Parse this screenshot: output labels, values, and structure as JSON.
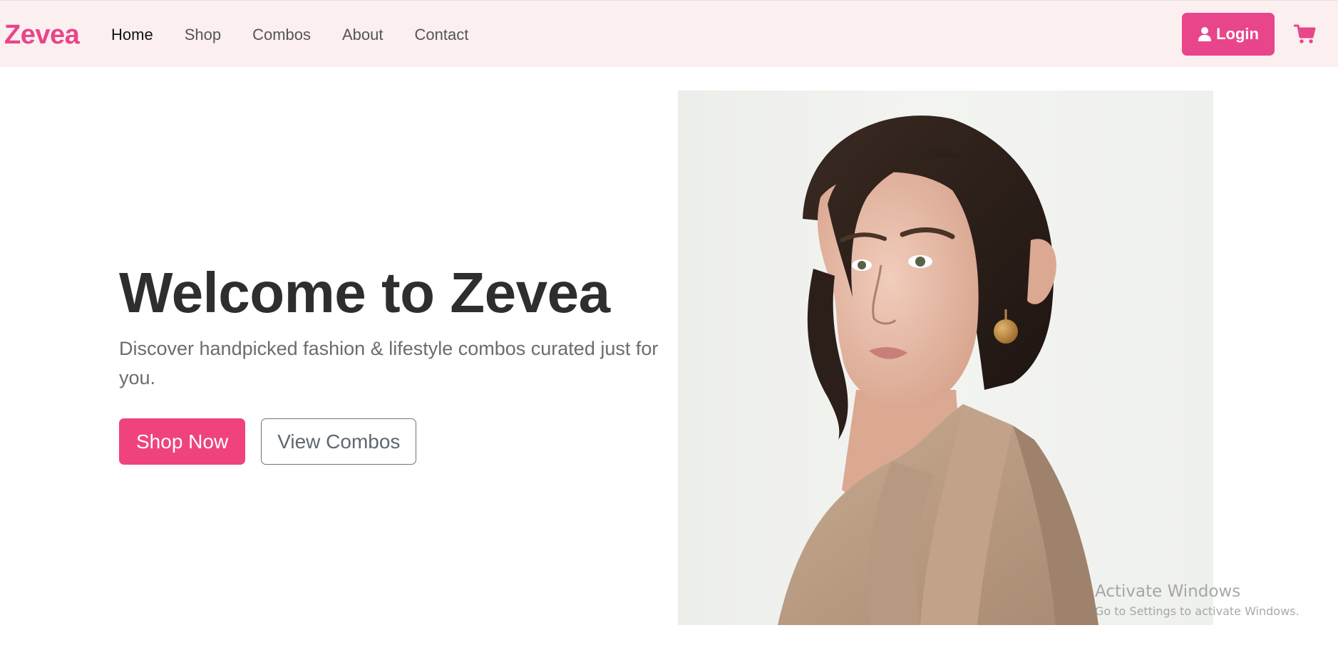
{
  "navbar": {
    "brand": "Zevea",
    "links": [
      {
        "label": "Home",
        "active": true
      },
      {
        "label": "Shop",
        "active": false
      },
      {
        "label": "Combos",
        "active": false
      },
      {
        "label": "About",
        "active": false
      },
      {
        "label": "Contact",
        "active": false
      }
    ],
    "login_label": "Login",
    "login_icon": "user-icon",
    "cart_icon": "shopping-cart-icon"
  },
  "hero": {
    "title": "Welcome to Zevea",
    "subtitle": "Discover handpicked fashion & lifestyle combos curated just for you.",
    "primary_button": "Shop Now",
    "secondary_button": "View Combos"
  },
  "watermark": {
    "title": "Activate Windows",
    "subtitle": "Go to Settings to activate Windows."
  },
  "colors": {
    "brand": "#e8458b",
    "primary_button": "#f0437e",
    "navbar_bg": "#fcefef",
    "heading": "#2e2e2e"
  }
}
